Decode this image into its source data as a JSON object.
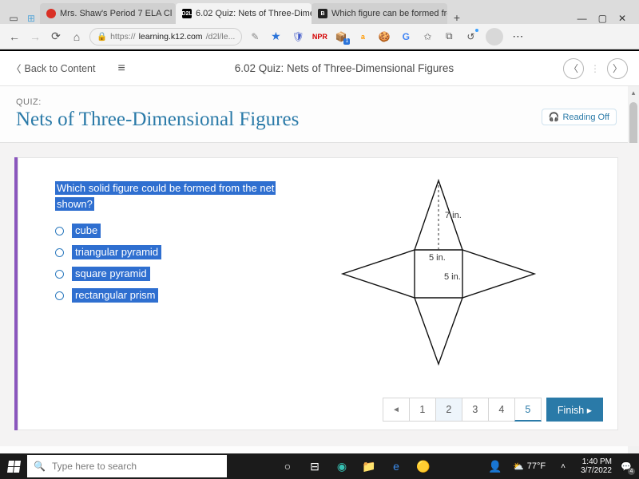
{
  "browser": {
    "tabs": [
      {
        "title": "Mrs. Shaw's Period 7 ELA Cl"
      },
      {
        "title": "6.02 Quiz: Nets of Three-Dimens"
      },
      {
        "title": "Which figure can be formed fro"
      }
    ],
    "url_lock": "🔒",
    "url_prefix": "https://",
    "url_host": "learning.k12.com",
    "url_path": "/d2l/le..."
  },
  "header": {
    "back": "Back to Content",
    "title": "6.02 Quiz: Nets of Three-Dimensional Figures"
  },
  "page": {
    "sub": "QUIZ:",
    "title": "Nets of Three-Dimensional Figures",
    "reading": "Reading  Off"
  },
  "question": {
    "line1": "Which solid figure could be formed from the net",
    "line2": "shown?",
    "options": [
      "cube",
      "triangular pyramid",
      "square pyramid",
      "rectangular prism"
    ],
    "dims": {
      "h": "7 in.",
      "w": "5 in.",
      "w2": "5 in."
    }
  },
  "pager": {
    "pages": [
      "1",
      "2",
      "3",
      "4",
      "5"
    ],
    "finish": "Finish ▸"
  },
  "taskbar": {
    "search": "Type here to search",
    "temp": "77°F",
    "time": "1:40 PM",
    "date": "3/7/2022"
  }
}
